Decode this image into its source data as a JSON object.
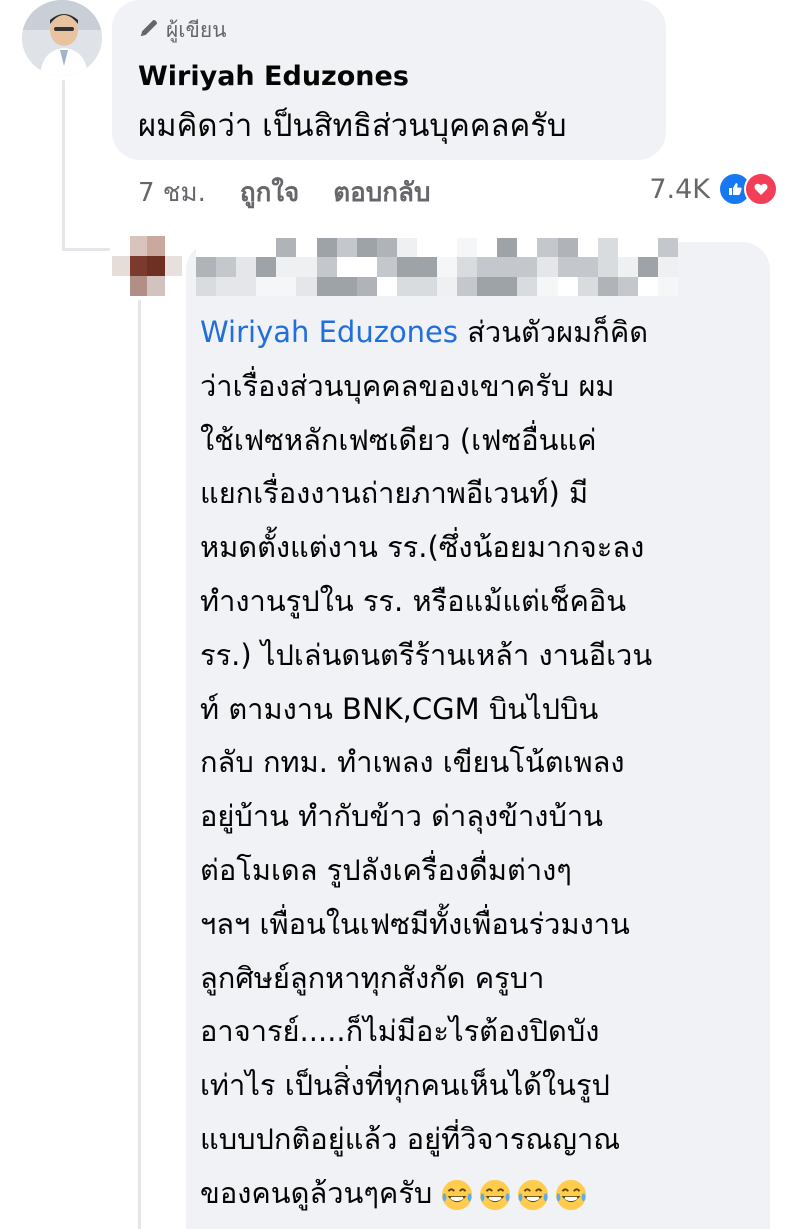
{
  "parent_comment": {
    "author_badge": "ผู้เขียน",
    "author_name": "Wiriyah Eduzones",
    "text": "ผมคิดว่า เป็นสิทธิส่วนบุคคลครับ",
    "time": "7 ชม.",
    "like_label": "ถูกใจ",
    "reply_label": "ตอบกลับ",
    "reaction_count": "7.4K",
    "reaction_icons": [
      "like-icon",
      "love-icon"
    ]
  },
  "reply_comment": {
    "author_name_blurred": "",
    "mention": "Wiriyah Eduzones",
    "lines": [
      " ส่วนตัวผมก็คิด",
      "ว่าเรื่องส่วนบุคคลของเขาครับ ผม",
      "ใช้เฟซหลักเฟซเดียว (เฟซอื่นแค่",
      "แยกเรื่องงานถ่ายภาพอีเวนท์) มี",
      "หมดตั้งแต่งาน รร.(ซึ่งน้อยมากจะลง",
      "ทำงานรูปใน รร. หรือแม้แต่เช็คอิน",
      "รร.) ไปเล่นดนตรีร้านเหล้า งานอีเวน",
      "ท์ ตามงาน BNK,CGM บินไปบิน",
      "กลับ กทม. ทำเพลง เขียนโน้ตเพลง",
      "อยู่บ้าน ทำกับข้าว ด่าลุงข้างบ้าน",
      "ต่อโมเดล  รูปลังเครื่องดื่มต่างๆ",
      "ฯลฯ เพื่อนในเฟซมีทั้งเพื่อนร่วมงาน",
      "ลูกศิษย์ลูกหาทุกสังกัด ครูบา",
      "อาจารย์.....ก็ไม่มีอะไรต้องปิดบัง",
      "เท่าไร เป็นสิ่งที่ทุกคนเห็นได้ในรูป",
      "แบบปกติอยู่แล้ว อยู่ที่วิจารณญาณ",
      "ของคนดูล้วนๆครับ"
    ],
    "emojis": [
      "laughing-crying-emoji",
      "laughing-crying-emoji",
      "laughing-crying-emoji",
      "laughing-crying-emoji"
    ]
  },
  "colors": {
    "bubble_bg": "#f0f2f5",
    "mention": "#216fdb",
    "meta_text": "#65676b",
    "like_blue": "#1877f2",
    "love_red": "#f33e58"
  }
}
